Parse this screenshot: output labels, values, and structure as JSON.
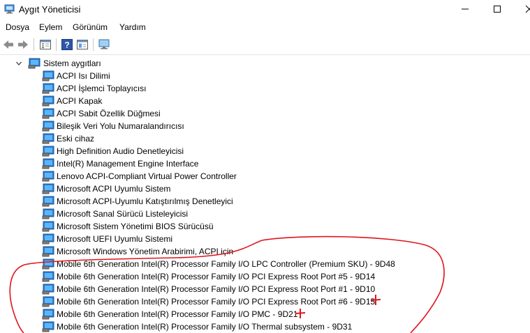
{
  "window": {
    "title": "Aygıt Yöneticisi"
  },
  "menu": {
    "items": [
      "Dosya",
      "Eylem",
      "Görünüm",
      "Yardım"
    ]
  },
  "toolbar": {
    "buttons": [
      "back-icon",
      "forward-icon",
      "properties-icon",
      "help-icon",
      "view-icon",
      "monitor-icon"
    ]
  },
  "tree": {
    "root_label": "Sistem aygıtları",
    "items": [
      "ACPI Isı Dilimi",
      "ACPI İşlemci Toplayıcısı",
      "ACPI Kapak",
      "ACPI Sabit Özellik Düğmesi",
      "Bileşik Veri Yolu Numaralandırıcısı",
      "Eski cihaz",
      "High Definition Audio Denetleyicisi",
      "Intel(R) Management Engine Interface",
      "Lenovo ACPI-Compliant Virtual Power Controller",
      "Microsoft ACPI Uyumlu Sistem",
      "Microsoft ACPI-Uyumlu Katıştırılmış Denetleyici",
      "Microsoft Sanal Sürücü Listeleyicisi",
      "Microsoft Sistem Yönetimi BIOS Sürücüsü",
      "Microsoft UEFI Uyumlu Sistemi",
      "Microsoft Windows Yönetim Arabirimi, ACPI için",
      "Mobile 6th Generation Intel(R) Processor Family I/O LPC Controller (Premium SKU) - 9D48",
      "Mobile 6th Generation Intel(R) Processor Family I/O PCI Express Root Port #5 - 9D14",
      "Mobile 6th Generation Intel(R) Processor Family I/O PCI Express Root Port #1 - 9D10",
      "Mobile 6th Generation Intel(R) Processor Family I/O PCI Express Root Port #6 - 9D15",
      "Mobile 6th Generation Intel(R) Processor Family I/O PMC - 9D21",
      "Mobile 6th Generation Intel(R) Processor Family I/O Thermal subsystem - 9D31"
    ]
  },
  "annotation_color": "#e0141b"
}
